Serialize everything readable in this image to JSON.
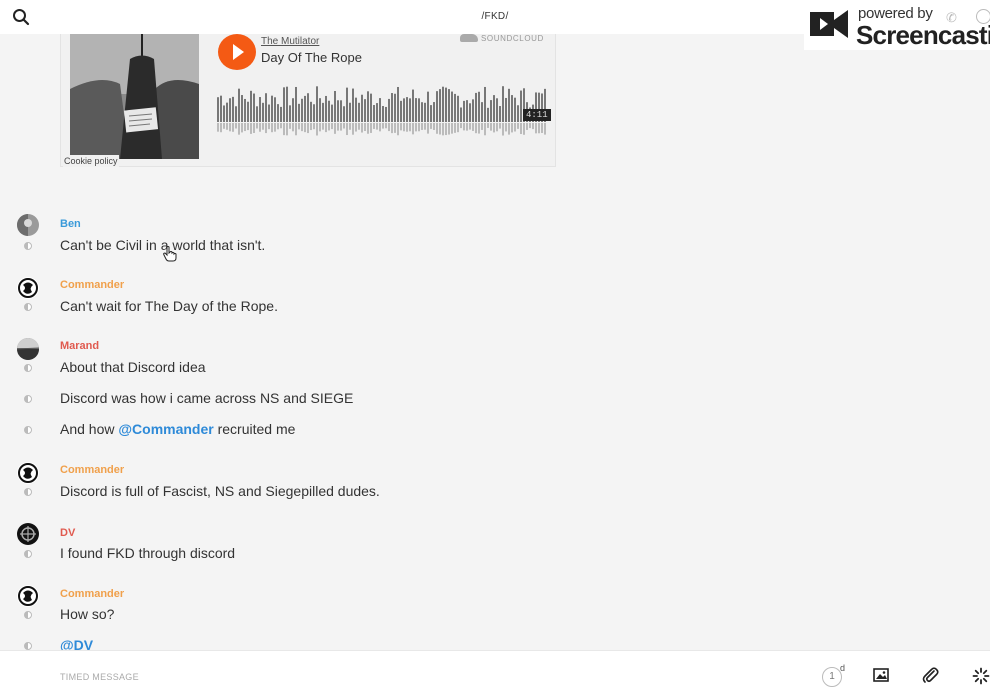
{
  "header": {
    "channel_title": "/FKD/"
  },
  "watermark": {
    "powered_by": "powered by",
    "brand": "Screencastify"
  },
  "embed": {
    "artist": "The Mutilator",
    "track": "Day Of The Rope",
    "source": "SOUNDCLOUD",
    "duration": "4:11",
    "cookie_policy": "Cookie policy"
  },
  "messages": [
    {
      "author": "Ben",
      "author_color": "#3a9ad9",
      "lines": [
        "Can't be Civil in a world that isn't."
      ]
    },
    {
      "author": "Commander",
      "author_color": "#f0a04b",
      "lines": [
        "Can't wait for The Day of the Rope."
      ]
    },
    {
      "author": "Marand",
      "author_color": "#e05a4f",
      "lines": [
        "About that Discord idea",
        "Discord was how i came across NS and SIEGE"
      ],
      "mention_line": {
        "mention": "@Commander",
        "before": "And how ",
        "after": " recruited me"
      }
    },
    {
      "author": "Commander",
      "author_color": "#f0a04b",
      "lines": [
        "Discord is full of Fascist, NS and Siegepilled dudes."
      ]
    },
    {
      "author": "DV",
      "author_color": "#e05a4f",
      "lines": [
        "I found FKD through discord"
      ]
    },
    {
      "author": "Commander",
      "author_color": "#f0a04b",
      "lines": [
        "How so?"
      ]
    },
    {
      "mention_only": "@DV"
    }
  ],
  "composer": {
    "placeholder": "TIMED MESSAGE",
    "timer_value": "1",
    "timer_unit": "d"
  },
  "icons": [
    "search-icon",
    "play-icon",
    "soundcloud-icon",
    "image-icon",
    "paperclip-icon",
    "loading-icon",
    "phone-icon",
    "info-icon",
    "hand-cursor-icon"
  ]
}
